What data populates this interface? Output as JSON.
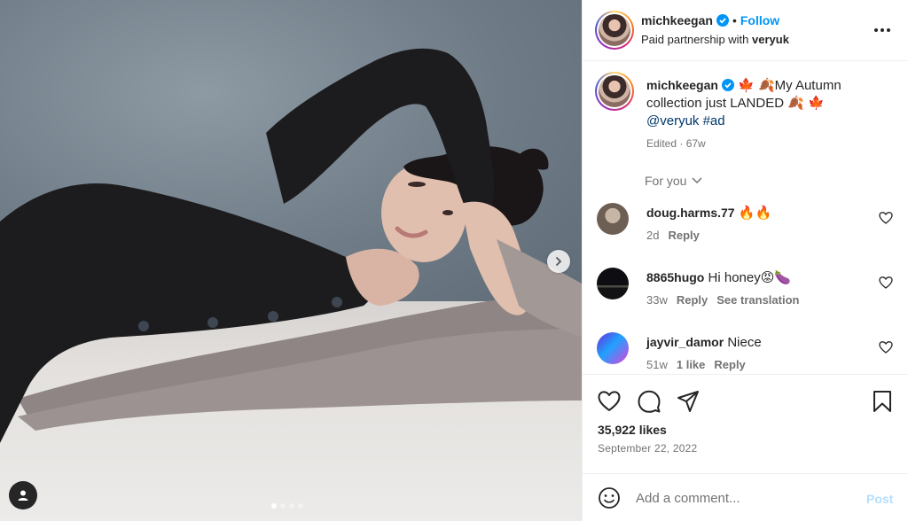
{
  "post": {
    "author": "michkeegan",
    "follow_label": "Follow",
    "separator": "•",
    "partnership_prefix": "Paid partnership with ",
    "partner": "veryuk"
  },
  "caption": {
    "text_part1": " 🍁 🍂My Autumn collection just LANDED 🍂 🍁",
    "mention": "@veryuk",
    "hashtag": "#ad",
    "edited": "Edited",
    "age": "67w"
  },
  "for_you_label": "For you",
  "comments": [
    {
      "username": "doug.harms.77",
      "text": "🔥🔥",
      "age": "2d",
      "likes": "",
      "reply": "Reply",
      "translate": ""
    },
    {
      "username": "8865hugo",
      "text": "Hi honey😡🍆",
      "age": "33w",
      "likes": "",
      "reply": "Reply",
      "translate": "See translation"
    },
    {
      "username": "jayvir_damor",
      "text": "Niece",
      "age": "51w",
      "likes": "1 like",
      "reply": "Reply",
      "translate": ""
    }
  ],
  "engagement": {
    "likes": "35,922 likes",
    "date": "September 22, 2022"
  },
  "composer": {
    "placeholder": "Add a comment...",
    "post_label": "Post"
  },
  "carousel": {
    "total": 4,
    "active_index": 0
  },
  "colors": {
    "accent": "#0095f6",
    "link": "#00376b",
    "muted": "#737373",
    "post_disabled": "#b2dffc"
  }
}
